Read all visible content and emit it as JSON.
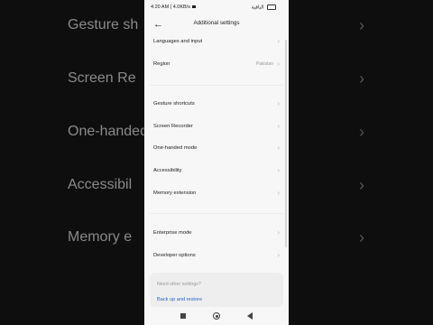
{
  "background": {
    "rows": [
      {
        "text": "Gesture sh",
        "y_label": "Gesture sh"
      },
      {
        "text": "Screen Re",
        "y_label": "Screen Re"
      },
      {
        "text": "One-handed",
        "y_label": "One-handed"
      },
      {
        "text": "Accessibil",
        "y_label": "Accessibil"
      },
      {
        "text": "Memory e",
        "y_label": "Memory e"
      }
    ]
  },
  "status": {
    "time": "4:20 AM",
    "speed": "4.0KB/s",
    "right_text": "الباقية"
  },
  "header": {
    "title": "Additional settings"
  },
  "rows": {
    "languages": "Languages and input",
    "region": "Region",
    "region_value": "Pakistan",
    "gesture": "Gesture shortcuts",
    "screen_recorder": "Screen Recorder",
    "one_handed": "One-handed mode",
    "accessibility": "Accessibility",
    "memory": "Memory extension",
    "enterprise": "Enterprise mode",
    "developer": "Developer options"
  },
  "card": {
    "question": "Need other settings?",
    "link": "Back up and restore"
  },
  "colors": {
    "background": "#f7f7f7",
    "link": "#2a64c9",
    "chevron": "#b8b8b8"
  },
  "icons": [
    "back-arrow-icon",
    "chevron-right-icon",
    "nav-square-icon",
    "nav-home-icon",
    "nav-back-icon"
  ]
}
